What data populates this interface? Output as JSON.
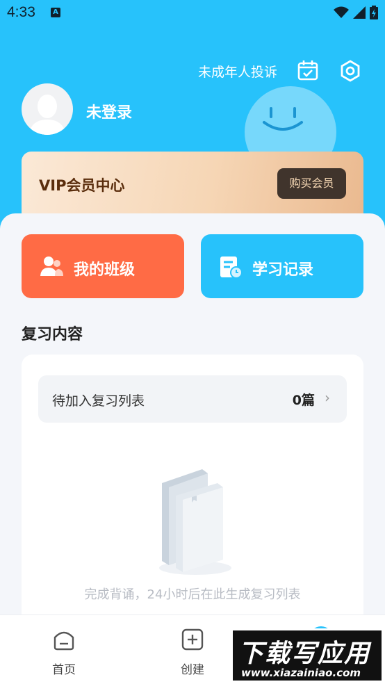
{
  "status_bar": {
    "time": "4:33",
    "notification_icon": "A"
  },
  "header": {
    "complaint_label": "未成年人投诉",
    "calendar_icon": "calendar-check-icon",
    "settings_icon": "hexagon-gear-icon",
    "login_text": "未登录"
  },
  "vip": {
    "title": "VIP会员中心",
    "buy_label": "购买会员"
  },
  "quick_actions": {
    "my_class": "我的班级",
    "study_record": "学习记录"
  },
  "review": {
    "section_title": "复习内容",
    "pending_label": "待加入复习列表",
    "pending_count": "0篇",
    "empty_text": "完成背诵，24小时后在此生成复习列表"
  },
  "tabbar": {
    "home": "首页",
    "create": "创建"
  },
  "watermark": {
    "cn": "下载写应用",
    "en": "www.xiazainiao.com"
  },
  "colors": {
    "primary": "#27c2fb",
    "orange": "#ff6b45",
    "vip_dark": "#40342c"
  }
}
